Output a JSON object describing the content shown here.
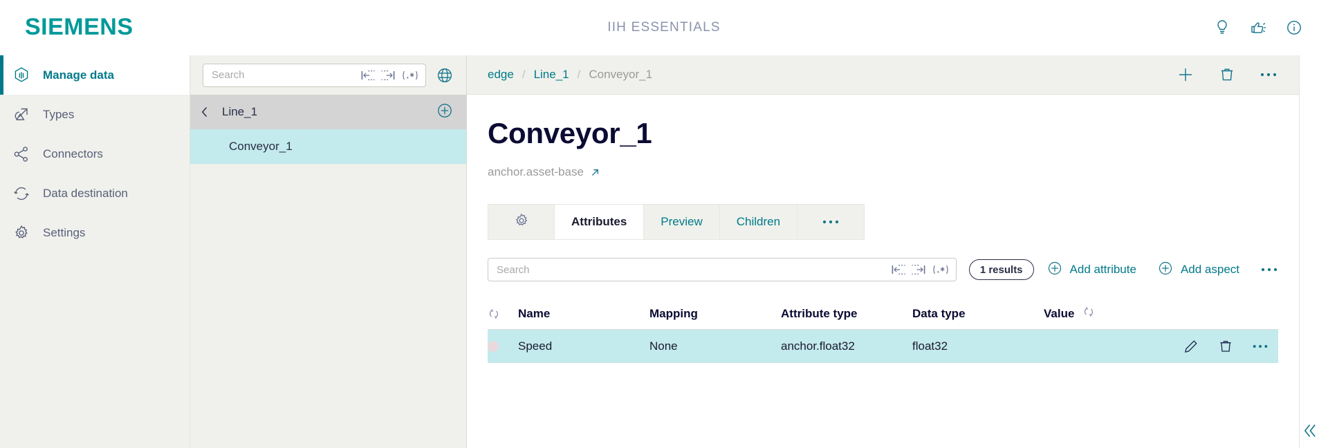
{
  "header": {
    "logo": "SIEMENS",
    "title": "IIH ESSENTIALS",
    "icons": [
      {
        "name": "lightbulb-icon",
        "label": "Tips"
      },
      {
        "name": "feedback-icon",
        "label": "Feedback"
      },
      {
        "name": "info-icon",
        "label": "Information"
      }
    ]
  },
  "sidebar": {
    "items": [
      {
        "label": "Manage data",
        "icon": "manage-data-icon",
        "active": true
      },
      {
        "label": "Types",
        "icon": "types-icon",
        "active": false
      },
      {
        "label": "Connectors",
        "icon": "connectors-icon",
        "active": false
      },
      {
        "label": "Data destination",
        "icon": "data-destination-icon",
        "active": false
      },
      {
        "label": "Settings",
        "icon": "settings-icon",
        "active": false
      }
    ]
  },
  "tree": {
    "search": {
      "placeholder": "Search",
      "value": ""
    },
    "search_icons": [
      "match-start-icon",
      "match-end-icon",
      "regex-icon"
    ],
    "globe_icon": "globe-icon",
    "header_label": "Line_1",
    "add_icon": "add-circle-icon",
    "back_icon": "chevron-left-icon",
    "nodes": [
      {
        "label": "Conveyor_1",
        "selected": true
      }
    ]
  },
  "breadcrumb": {
    "items": [
      {
        "label": "edge",
        "last": false
      },
      {
        "label": "Line_1",
        "last": false
      },
      {
        "label": "Conveyor_1",
        "last": true
      }
    ],
    "separator": "/",
    "actions": [
      {
        "name": "add-icon",
        "label": "Add"
      },
      {
        "name": "delete-icon",
        "label": "Delete"
      },
      {
        "name": "more-icon",
        "label": "More"
      }
    ]
  },
  "detail": {
    "title": "Conveyor_1",
    "subtitle": "anchor.asset-base",
    "subtitle_link_icon": "external-link-icon",
    "tabs": [
      {
        "label": "",
        "icon": "gear-icon",
        "active": false
      },
      {
        "label": "Attributes",
        "icon": "",
        "active": true
      },
      {
        "label": "Preview",
        "icon": "",
        "active": false
      },
      {
        "label": "Children",
        "icon": "",
        "active": false
      },
      {
        "label": "•••",
        "icon": "",
        "active": false
      }
    ]
  },
  "attributes": {
    "search": {
      "placeholder": "Search",
      "value": ""
    },
    "search_icons": [
      "match-start-icon",
      "match-end-icon",
      "regex-icon"
    ],
    "results_badge": "1 results",
    "add_attribute_label": "Add attribute",
    "add_aspect_label": "Add aspect",
    "more_label": "More options",
    "columns": [
      "Name",
      "Mapping",
      "Attribute type",
      "Data type",
      "Value"
    ],
    "rows": [
      {
        "name": "Speed",
        "mapping": "None",
        "attribute_type": "anchor.float32",
        "data_type": "float32",
        "value": "",
        "selected": true,
        "actions": [
          "edit-icon",
          "delete-icon",
          "more-icon"
        ]
      }
    ]
  },
  "footer": {
    "collapse_icon": "collapse-left-icon"
  },
  "colors": {
    "brand_teal": "#009999",
    "accent_teal": "#007a8a",
    "selection": "#c3eaec",
    "panel_bg": "#f0f1ec",
    "title_navy": "#0b0b33"
  }
}
